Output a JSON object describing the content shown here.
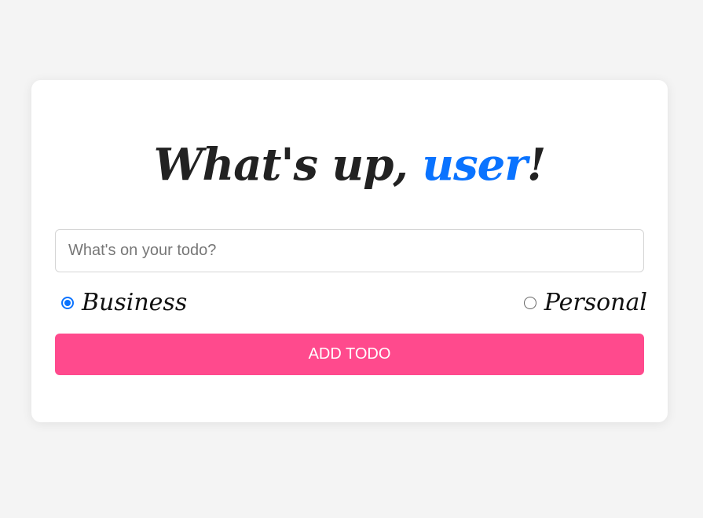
{
  "title": {
    "prefix": "What's up, ",
    "username": "user",
    "suffix": "!"
  },
  "todo_input": {
    "value": "",
    "placeholder": "What's on your todo?"
  },
  "category": {
    "options": [
      {
        "label": "Business",
        "checked": true
      },
      {
        "label": "Personal",
        "checked": false
      }
    ],
    "selected": "Business"
  },
  "add_button": {
    "label": "ADD TODO"
  },
  "colors": {
    "page_background": "#f4f4f4",
    "card_background": "#ffffff",
    "accent": "#0a73ff",
    "button": "#ff4a8d",
    "text": "#222222"
  }
}
